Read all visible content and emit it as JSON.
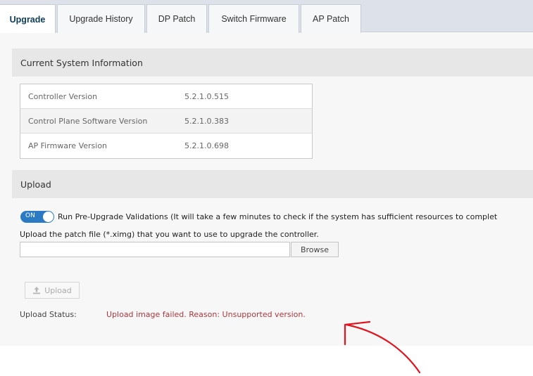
{
  "tabs": [
    {
      "label": "Upgrade",
      "active": true
    },
    {
      "label": "Upgrade History",
      "active": false
    },
    {
      "label": "DP Patch",
      "active": false
    },
    {
      "label": "Switch Firmware",
      "active": false
    },
    {
      "label": "AP Patch",
      "active": false
    }
  ],
  "system_info": {
    "title": "Current System Information",
    "rows": [
      {
        "label": "Controller Version",
        "value": "5.2.1.0.515"
      },
      {
        "label": "Control Plane Software Version",
        "value": "5.2.1.0.383"
      },
      {
        "label": "AP Firmware Version",
        "value": "5.2.1.0.698"
      }
    ]
  },
  "upload": {
    "title": "Upload",
    "toggle_state": "ON",
    "toggle_label": "Run Pre-Upgrade Validations (It will take a few minutes to check if the system has sufficient resources to complet",
    "hint": "Upload the patch file (*.ximg) that you want to use to upgrade the controller.",
    "file_value": "",
    "browse_label": "Browse",
    "upload_label": "Upload",
    "upload_icon": "upload-icon",
    "status_label": "Upload Status:",
    "status_value": "Upload image failed. Reason: Unsupported version."
  },
  "colors": {
    "accent": "#2b7bc4",
    "error": "#b0363c",
    "annotation": "#e0141e"
  }
}
